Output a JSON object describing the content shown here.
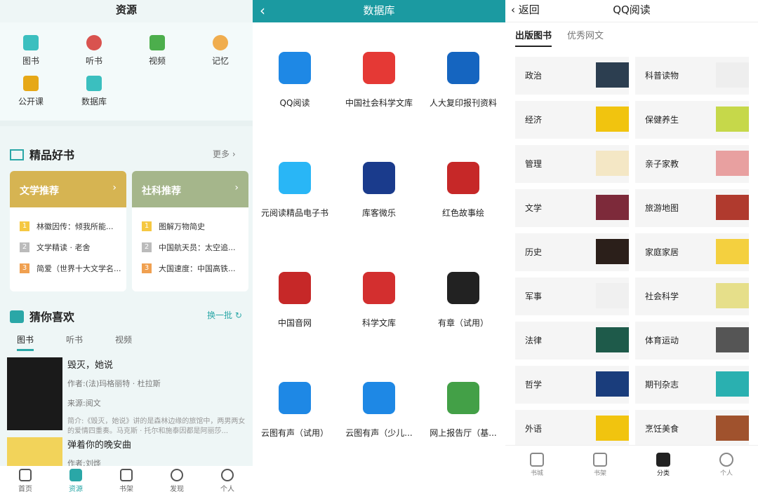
{
  "p1": {
    "title": "资源",
    "resources": [
      {
        "label": "图书",
        "icon": "book-icon",
        "color": "#3bbfbf"
      },
      {
        "label": "听书",
        "icon": "headphones-icon",
        "color": "#d9534f"
      },
      {
        "label": "视频",
        "icon": "video-icon",
        "color": "#4cae4c"
      },
      {
        "label": "记忆",
        "icon": "memory-icon",
        "color": "#f0ad4e"
      },
      {
        "label": "公开课",
        "icon": "open-class-icon",
        "color": "#e6a817"
      },
      {
        "label": "数据库",
        "icon": "database-icon",
        "color": "#3bbfbf"
      }
    ],
    "featured_title": "精品好书",
    "more": "更多",
    "cards": [
      {
        "title": "文学推荐",
        "color": "#d6b452",
        "items": [
          "林徽因传：倾我所能...",
          "文学精读 · 老舍",
          "简爱（世界十大文学名..."
        ]
      },
      {
        "title": "社科推荐",
        "color": "#a5b68b",
        "items": [
          "图解万物简史",
          "中国航天员：太空追...",
          "大国速度：中国高铁..."
        ]
      }
    ],
    "rank_colors": [
      "#f5c842",
      "#bbbbbb",
      "#f0a050"
    ],
    "ranks": [
      "1",
      "2",
      "3"
    ],
    "guess_title": "猜你喜欢",
    "refresh": "换一批",
    "tabs": [
      "图书",
      "听书",
      "视频"
    ],
    "books": [
      {
        "title": "毁灭，她说",
        "author": "作者:(法)玛格丽特 · 杜拉斯",
        "source": "来源:阅文",
        "desc": "简介:《毁灭，她说》讲的是森林边缘的旅馆中，两男两女的爱情四重奏。马克斯 · 托尔和施泰因都是阿丽莎..."
      },
      {
        "title": "弹着你的晚安曲",
        "author": "作者:刘烨",
        "source": "",
        "desc": ""
      }
    ],
    "nav": [
      "首页",
      "资源",
      "书架",
      "发现",
      "个人"
    ]
  },
  "p2": {
    "back": "‹",
    "title": "数据库",
    "items": [
      {
        "label": "QQ阅读",
        "color": "#1e88e5"
      },
      {
        "label": "中国社会科学文库",
        "color": "#e53935"
      },
      {
        "label": "人大复印报刊资料",
        "color": "#1565c0"
      },
      {
        "label": "元阅读精品电子书",
        "color": "#29b6f6"
      },
      {
        "label": "库客微乐",
        "color": "#1a3b8c"
      },
      {
        "label": "红色故事绘",
        "color": "#c62828"
      },
      {
        "label": "中国音网",
        "color": "#c62828"
      },
      {
        "label": "科学文库",
        "color": "#d32f2f"
      },
      {
        "label": "有章（试用）",
        "color": "#222222"
      },
      {
        "label": "云图有声（试用）",
        "color": "#1e88e5"
      },
      {
        "label": "云图有声（少儿...",
        "color": "#1e88e5"
      },
      {
        "label": "网上报告厅（基...",
        "color": "#43a047"
      }
    ]
  },
  "p3": {
    "back": "‹ 返回",
    "title": "QQ阅读",
    "tabs": [
      "出版图书",
      "优秀网文"
    ],
    "categories": [
      {
        "name": "政治",
        "color": "#2c3e50"
      },
      {
        "name": "科普读物",
        "color": "#eeeeee"
      },
      {
        "name": "经济",
        "color": "#f1c40f"
      },
      {
        "name": "保健养生",
        "color": "#c6d84a"
      },
      {
        "name": "管理",
        "color": "#f4e7c5"
      },
      {
        "name": "亲子家教",
        "color": "#e8a0a0"
      },
      {
        "name": "文学",
        "color": "#7d2a3a"
      },
      {
        "name": "旅游地图",
        "color": "#b03a2e"
      },
      {
        "name": "历史",
        "color": "#2b1f1a"
      },
      {
        "name": "家庭家居",
        "color": "#f4d03f"
      },
      {
        "name": "军事",
        "color": "#f0f0f0"
      },
      {
        "name": "社会科学",
        "color": "#e6df8a"
      },
      {
        "name": "法律",
        "color": "#1e5a4a"
      },
      {
        "name": "体育运动",
        "color": "#555555"
      },
      {
        "name": "哲学",
        "color": "#1a3d7c"
      },
      {
        "name": "期刊杂志",
        "color": "#2ab0b0"
      },
      {
        "name": "外语",
        "color": "#f1c40f"
      },
      {
        "name": "烹饪美食",
        "color": "#a0522d"
      }
    ],
    "nav": [
      "书城",
      "书架",
      "分类",
      "个人"
    ]
  }
}
